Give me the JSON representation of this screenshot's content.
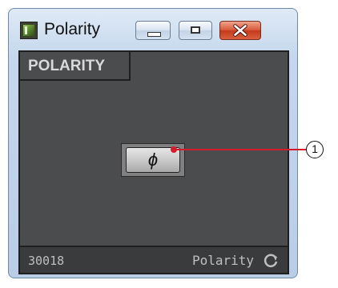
{
  "window": {
    "title": "Polarity",
    "icon": "app-icon"
  },
  "titlebar_buttons": {
    "minimize_icon": "minimize-icon",
    "maximize_icon": "maximize-icon",
    "close_icon": "close-icon"
  },
  "panel": {
    "section_label": "POLARITY",
    "phase_button_label": "ϕ"
  },
  "statusbar": {
    "id": "30018",
    "component_name": "Polarity",
    "sync_icon": "sync-icon"
  },
  "callout": {
    "number": "1"
  },
  "colors": {
    "panel_bg": "#4b4c4e",
    "callout": "#d41c2c",
    "close_button": "#c23a1c"
  }
}
